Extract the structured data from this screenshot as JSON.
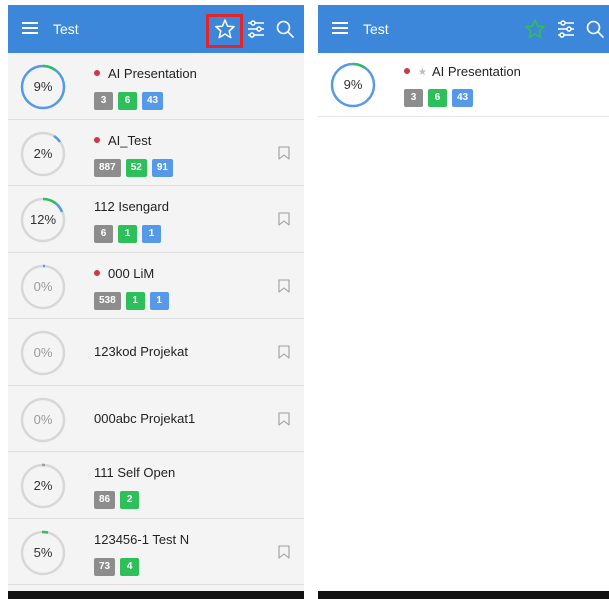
{
  "left": {
    "appbar": {
      "title": "Test"
    },
    "projects": [
      {
        "percent": 9,
        "percent_label": "9%",
        "name": "AI Presentation",
        "dot": true,
        "bookmark": false,
        "badges": {
          "gray": "3",
          "green": "6",
          "blue": "43"
        }
      },
      {
        "percent": 2,
        "percent_label": "2%",
        "name": "AI_Test",
        "dot": true,
        "bookmark": true,
        "badges": {
          "gray": "887",
          "green": "52",
          "blue": "91"
        }
      },
      {
        "percent": 12,
        "percent_label": "12%",
        "name": "112 Isengard",
        "dot": false,
        "bookmark": true,
        "badges": {
          "gray": "6",
          "green": "1",
          "blue": "1"
        }
      },
      {
        "percent": 0,
        "percent_label": "0%",
        "name": "000 LiM",
        "dot": true,
        "bookmark": true,
        "badges": {
          "gray": "538",
          "green": "1",
          "blue": "1"
        }
      },
      {
        "percent": 0,
        "percent_label": "0%",
        "name": "123kod Projekat",
        "dot": false,
        "bookmark": true,
        "badges": null
      },
      {
        "percent": 0,
        "percent_label": "0%",
        "name": "000abc Projekat1",
        "dot": false,
        "bookmark": true,
        "badges": null
      },
      {
        "percent": 2,
        "percent_label": "2%",
        "name": "111 Self Open",
        "dot": false,
        "bookmark": false,
        "badges": {
          "gray": "86",
          "green": "2"
        }
      },
      {
        "percent": 5,
        "percent_label": "5%",
        "name": "123456-1 Test N",
        "dot": false,
        "bookmark": true,
        "badges": {
          "gray": "73",
          "green": "4"
        }
      }
    ]
  },
  "right": {
    "appbar": {
      "title": "Test"
    },
    "projects": [
      {
        "percent": 9,
        "percent_label": "9%",
        "name": "AI Presentation",
        "dot": true,
        "starred": true,
        "badges": {
          "gray": "3",
          "green": "6",
          "blue": "43"
        }
      }
    ]
  },
  "icons": {
    "menu": "menu-icon",
    "favorite": "star-icon",
    "filter": "filter-icon",
    "search": "search-icon",
    "bookmark": "bookmark-icon"
  },
  "colors": {
    "appbar": "#3d87db",
    "highlight": "#e0262b",
    "progress_arc_green": "#2cbf5a",
    "progress_arc_blue": "#5799e9",
    "badge_gray": "#8d8d8d",
    "badge_green": "#2cbf5a",
    "badge_blue": "#5799e9",
    "status_dot": "#d1344b",
    "star_active": "#2cbf5a"
  }
}
